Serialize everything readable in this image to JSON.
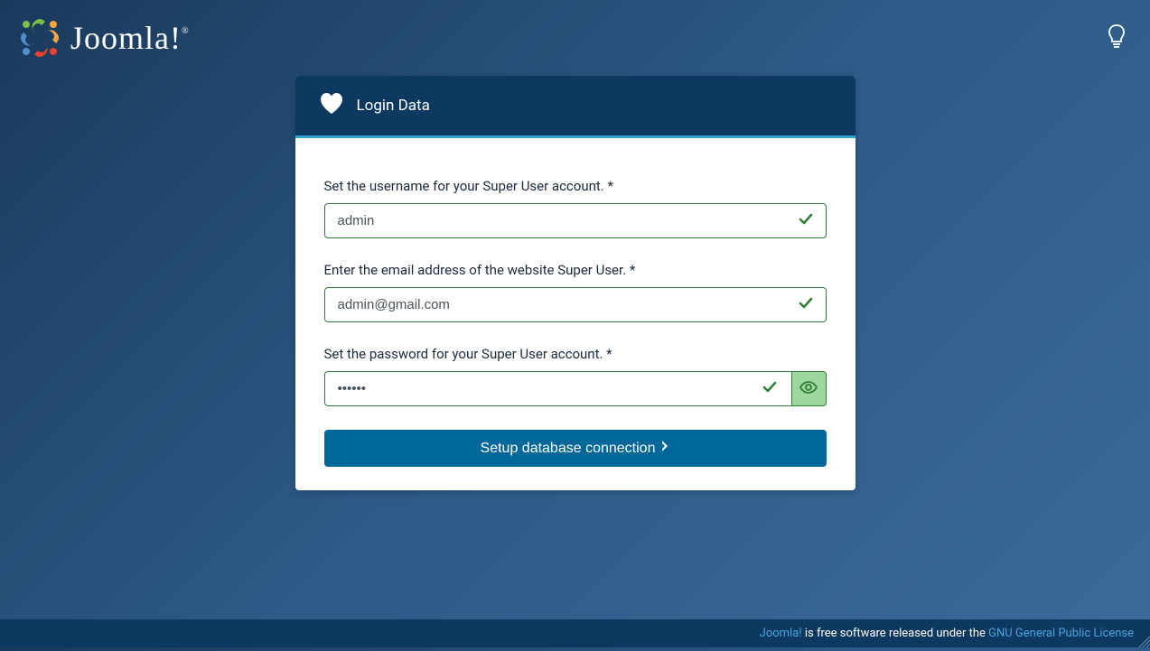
{
  "header": {
    "brand": "Joomla!",
    "brand_suffix": "®"
  },
  "card": {
    "title": "Login Data"
  },
  "form": {
    "username": {
      "label": "Set the username for your Super User account. *",
      "value": "admin"
    },
    "email": {
      "label": "Enter the email address of the website Super User. *",
      "value": "admin@gmail.com"
    },
    "password": {
      "label": "Set the password for your Super User account. *",
      "value": "••••••"
    },
    "submit_label": "Setup database connection"
  },
  "footer": {
    "link1": "Joomla!",
    "text": " is free software released under the ",
    "link2": "GNU General Public License"
  }
}
